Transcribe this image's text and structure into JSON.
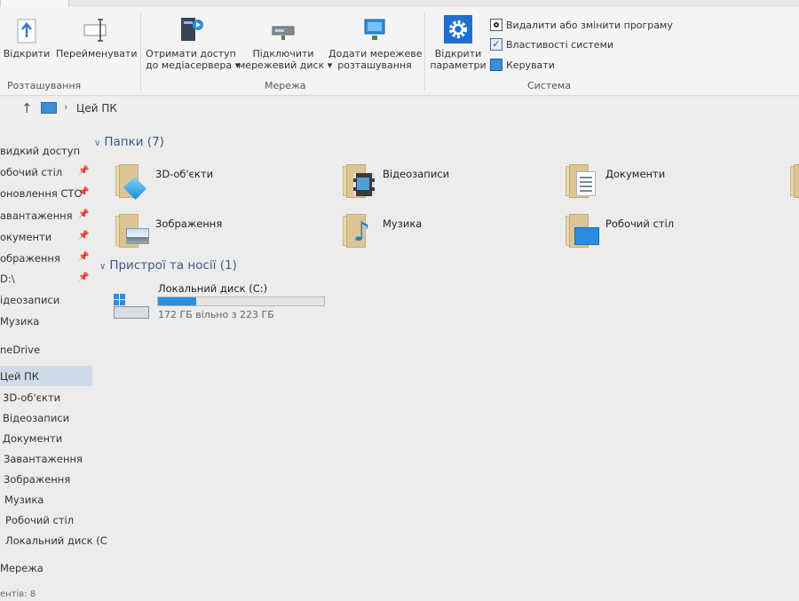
{
  "ribbon": {
    "location": {
      "open_label": "Відкрити",
      "rename_label": "Перейменувати",
      "group_label": "Розташування"
    },
    "network": {
      "media_line1": "Отримати доступ",
      "media_line2": "до медіасервера",
      "map_line1": "Підключити",
      "map_line2": "мережевий диск",
      "add_line1": "Додати мережеве",
      "add_line2": "розташування",
      "group_label": "Мережа"
    },
    "system": {
      "settings_line1": "Відкрити",
      "settings_line2": "параметри",
      "uninstall_label": "Видалити або змінити програму",
      "properties_label": "Властивості системи",
      "manage_label": "Керувати",
      "group_label": "Система"
    }
  },
  "address": {
    "path": "Цей ПК"
  },
  "nav": {
    "items": [
      "видкий доступ",
      "обочий стіл",
      "оновлення СТО",
      "авантаження",
      "окументи",
      "ображення",
      "D:\\",
      "ідеозаписи",
      "Музика",
      "neDrive",
      "Цей ПК",
      "3D-об'єкти",
      "Відеозаписи",
      "Документи",
      "Завантаження",
      "Зображення",
      "Музика",
      "Робочий стіл",
      "Локальний диск (C",
      "Мережа"
    ]
  },
  "content": {
    "folders_header": "Папки (7)",
    "folders": [
      "3D-об'єкти",
      "Відеозаписи",
      "Документи",
      "Зображення",
      "Музика",
      "Робочий стіл"
    ],
    "devices_header": "Пристрої та носії (1)",
    "drive": {
      "name": "Локальний диск (C:)",
      "free_text": "172 ГБ вільно з 223 ГБ",
      "used_fraction": 0.229
    }
  },
  "status": {
    "text": "ентів: 8"
  },
  "colors": {
    "accent": "#2a8de0",
    "section_header": "#3b5a86",
    "selection": "#cfdbe8",
    "folder": "#dcc594"
  }
}
